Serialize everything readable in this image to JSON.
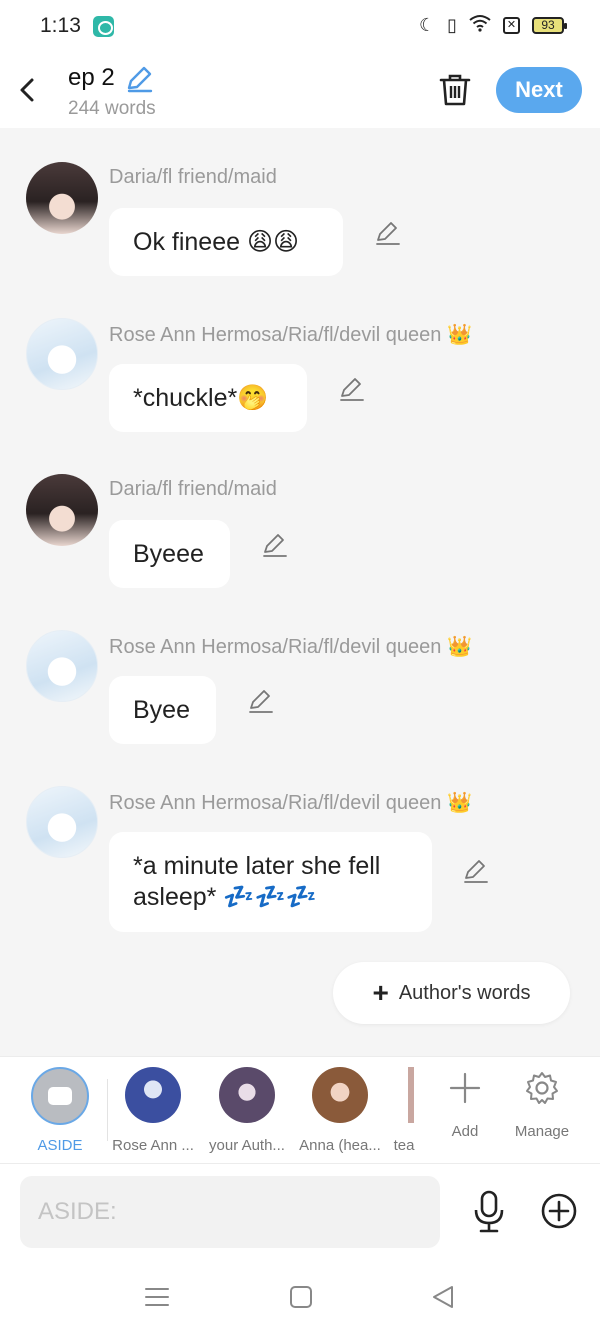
{
  "status_bar": {
    "time": "1:13",
    "battery": "93"
  },
  "header": {
    "title": "ep 2",
    "word_count": "244 words",
    "next_label": "Next"
  },
  "messages": [
    {
      "sender": "Daria/fl friend/maid",
      "text": "Ok fineee 😩😩",
      "avatar": "dark-haired-girl"
    },
    {
      "sender": "Rose Ann Hermosa/Ria/fl/devil queen 👑",
      "text": "*chuckle*🤭",
      "avatar": "white-haired-girl"
    },
    {
      "sender": "Daria/fl friend/maid",
      "text": "Byeee",
      "avatar": "dark-haired-girl"
    },
    {
      "sender": "Rose Ann Hermosa/Ria/fl/devil queen 👑",
      "text": "Byee",
      "avatar": "white-haired-girl"
    },
    {
      "sender": "Rose Ann Hermosa/Ria/fl/devil queen 👑",
      "text": "*a minute later she fell asleep* 💤💤💤",
      "avatar": "white-haired-girl"
    }
  ],
  "authors_words_label": "Author's words",
  "strip": {
    "aside_label": "ASIDE",
    "characters": [
      {
        "label": "Rose Ann ...",
        "color": "#3b4fa0"
      },
      {
        "label": "your Auth...",
        "color": "#5a4a6a"
      },
      {
        "label": "Anna (hea...",
        "color": "#8a5a3a"
      },
      {
        "label": "tea",
        "color": "#c9a7a0"
      }
    ],
    "add_label": "Add",
    "manage_label": "Manage"
  },
  "input": {
    "placeholder": "ASIDE:",
    "value": ""
  },
  "colors": {
    "accent": "#5aa8ee",
    "background": "#f5f5f5",
    "bubble": "#ffffff"
  }
}
